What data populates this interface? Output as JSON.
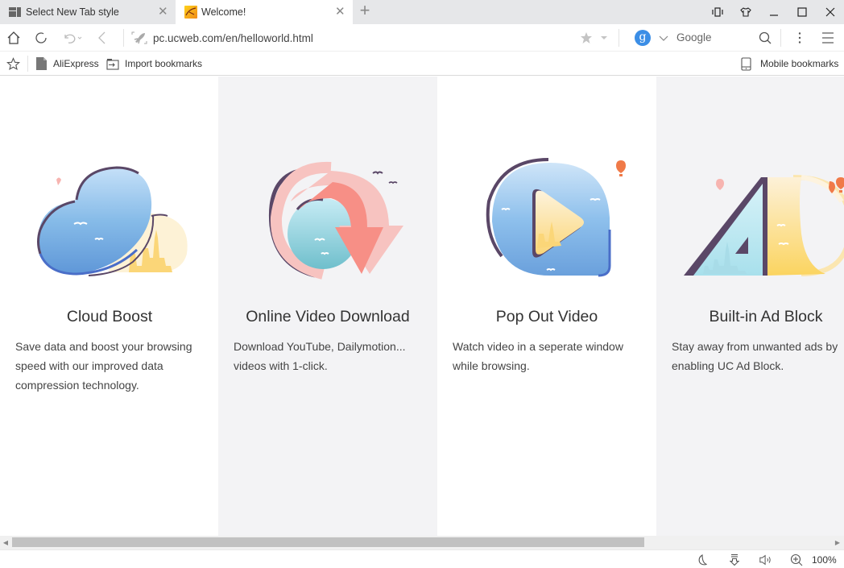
{
  "tabs": [
    {
      "title": "Select New Tab style",
      "active": false,
      "icon": "grid-layout-icon"
    },
    {
      "title": "Welcome!",
      "active": true,
      "icon": "uc-favicon-icon"
    }
  ],
  "new_tab_label": "+",
  "window_controls": [
    "reader-mode-icon",
    "skin-icon",
    "minimize-icon",
    "maximize-icon",
    "close-icon"
  ],
  "toolbar": {
    "url": "pc.ucweb.com/en/helloworld.html",
    "search_engine_letter": "g",
    "search_placeholder": "Google",
    "icons": [
      "home-icon",
      "reload-icon",
      "undo-icon",
      "back-icon",
      "rocket-icon",
      "star-icon",
      "chevron-down-icon",
      "search-icon",
      "more-vertical-icon",
      "menu-icon"
    ]
  },
  "bookmarks": {
    "items": [
      {
        "label": "AliExpress",
        "icon": "page-icon"
      },
      {
        "label": "Import bookmarks",
        "icon": "import-icon"
      }
    ],
    "mobile_label": "Mobile bookmarks"
  },
  "features": [
    {
      "title": "Cloud Boost",
      "description": "Save data and boost your browsing speed with our improved data compression technology.",
      "illustration": "cloud-icon"
    },
    {
      "title": "Online Video Download",
      "description": "Download YouTube, Dailymotion... videos with 1-click.",
      "illustration": "download-arrow-icon"
    },
    {
      "title": "Pop Out Video",
      "description": "Watch video in a seperate window while browsing.",
      "illustration": "play-bubble-icon"
    },
    {
      "title": "Built-in Ad Block",
      "description": "Stay away from unwanted ads by enabling UC Ad Block.",
      "illustration": "ad-block-icon"
    }
  ],
  "colors": {
    "accent_blue": "#3b8ee6",
    "sky_blue": "#7fb3e6",
    "coral": "#f78f86",
    "pink": "#f7c3c0",
    "purple_outline": "#5a4767",
    "sand": "#fde9a6",
    "teal": "#8ed0dc"
  },
  "statusbar": {
    "zoom": "100%",
    "icons": [
      "night-mode-icon",
      "download-icon",
      "volume-icon",
      "zoom-in-icon"
    ]
  }
}
